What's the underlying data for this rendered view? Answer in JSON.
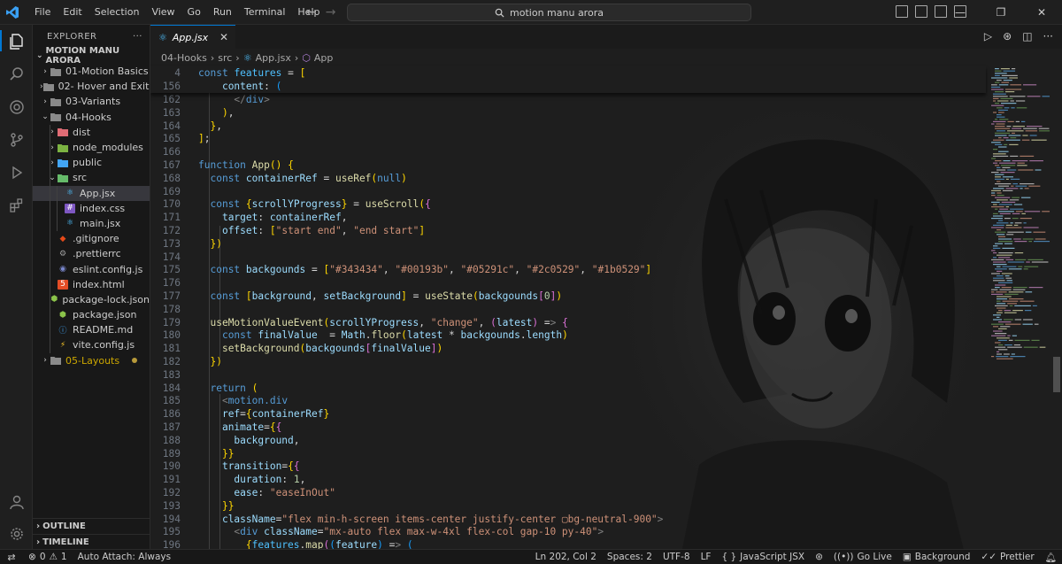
{
  "menu": [
    "File",
    "Edit",
    "Selection",
    "View",
    "Go",
    "Run",
    "Terminal",
    "Help"
  ],
  "search": {
    "text": "motion manu arora"
  },
  "sidebar": {
    "title": "EXPLORER",
    "more": "···",
    "root": "MOTION MANU ARORA",
    "items": [
      {
        "label": "01-Motion Basics"
      },
      {
        "label": "02- Hover and Exit..."
      },
      {
        "label": "03-Variants"
      },
      {
        "label": "04-Hooks"
      },
      {
        "label": "dist"
      },
      {
        "label": "node_modules"
      },
      {
        "label": "public"
      },
      {
        "label": "src"
      },
      {
        "label": "App.jsx"
      },
      {
        "label": "index.css"
      },
      {
        "label": "main.jsx"
      },
      {
        "label": ".gitignore"
      },
      {
        "label": ".prettierrc"
      },
      {
        "label": "eslint.config.js"
      },
      {
        "label": "index.html"
      },
      {
        "label": "package-lock.json"
      },
      {
        "label": "package.json"
      },
      {
        "label": "README.md"
      },
      {
        "label": "vite.config.js"
      },
      {
        "label": "05-Layouts"
      }
    ],
    "outline": "OUTLINE",
    "timeline": "TIMELINE"
  },
  "editor": {
    "tab": "App.jsx",
    "breadcrumb": [
      "04-Hooks",
      "src",
      "App.jsx",
      "App"
    ],
    "sticky": [
      {
        "n": "4",
        "t": "const features = ["
      },
      {
        "n": "156",
        "t": "    content: ("
      }
    ],
    "lines": [
      {
        "n": "162",
        "t": "      </div>"
      },
      {
        "n": "163",
        "t": "    ),"
      },
      {
        "n": "164",
        "t": "  },"
      },
      {
        "n": "165",
        "t": "];"
      },
      {
        "n": "166",
        "t": ""
      },
      {
        "n": "167",
        "t": "function App() {"
      },
      {
        "n": "168",
        "t": "  const containerRef = useRef(null)"
      },
      {
        "n": "169",
        "t": ""
      },
      {
        "n": "170",
        "t": "  const {scrollYProgress} = useScroll({"
      },
      {
        "n": "171",
        "t": "    target: containerRef,"
      },
      {
        "n": "172",
        "t": "    offset: [\"start end\", \"end start\"]"
      },
      {
        "n": "173",
        "t": "  })"
      },
      {
        "n": "174",
        "t": ""
      },
      {
        "n": "175",
        "t": "  const backgounds = [\"#343434\", \"#00193b\", \"#05291c\", \"#2c0529\", \"#1b0529\"]"
      },
      {
        "n": "176",
        "t": ""
      },
      {
        "n": "177",
        "t": "  const [background, setBackground] = useState(backgounds[0])"
      },
      {
        "n": "178",
        "t": ""
      },
      {
        "n": "179",
        "t": "  useMotionValueEvent(scrollYProgress, \"change\", (latest) => {"
      },
      {
        "n": "180",
        "t": "    const finalValue  = Math.floor(latest * backgounds.length)"
      },
      {
        "n": "181",
        "t": "    setBackground(backgounds[finalValue])"
      },
      {
        "n": "182",
        "t": "  })"
      },
      {
        "n": "183",
        "t": ""
      },
      {
        "n": "184",
        "t": "  return ("
      },
      {
        "n": "185",
        "t": "    <motion.div"
      },
      {
        "n": "186",
        "t": "    ref={containerRef}"
      },
      {
        "n": "187",
        "t": "    animate={{"
      },
      {
        "n": "188",
        "t": "      background,"
      },
      {
        "n": "189",
        "t": "    }}"
      },
      {
        "n": "190",
        "t": "    transition={{"
      },
      {
        "n": "191",
        "t": "      duration: 1,"
      },
      {
        "n": "192",
        "t": "      ease: \"easeInOut\""
      },
      {
        "n": "193",
        "t": "    }}"
      },
      {
        "n": "194",
        "t": "    className=\"flex min-h-screen items-center justify-center ▢bg-neutral-900\">"
      },
      {
        "n": "195",
        "t": "      <div className=\"mx-auto flex max-w-4xl flex-col gap-10 py-40\">"
      },
      {
        "n": "196",
        "t": "        {features.map((feature) => ("
      }
    ]
  },
  "status": {
    "errors": "0",
    "warnings": "1",
    "auto_attach": "Auto Attach: Always",
    "position": "Ln 202, Col 2",
    "spaces": "Spaces: 2",
    "encoding": "UTF-8",
    "eol": "LF",
    "language": "JavaScript JSX",
    "golive": "Go Live",
    "background": "Background",
    "prettier": "Prettier"
  }
}
